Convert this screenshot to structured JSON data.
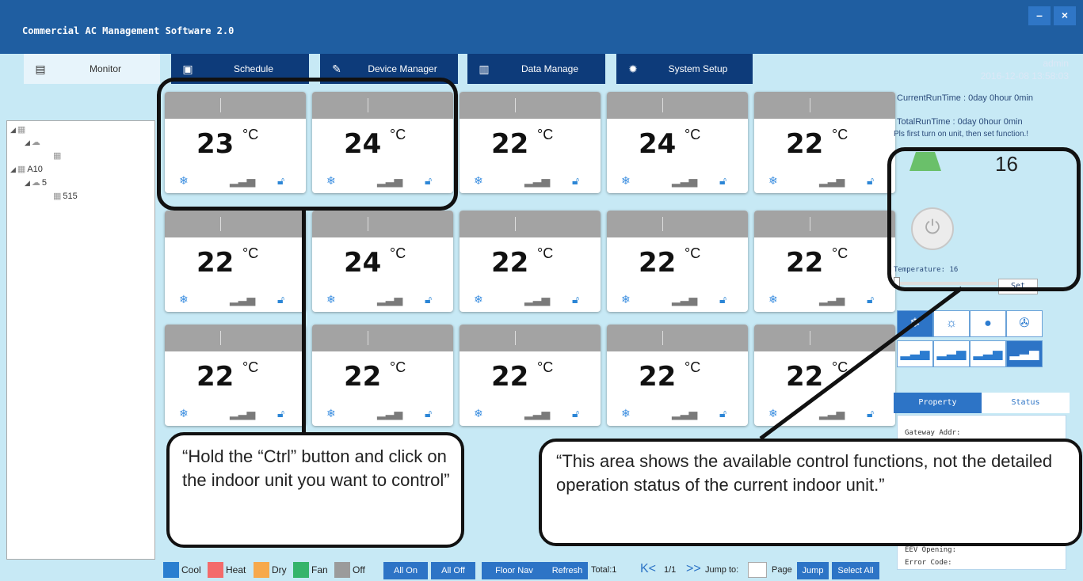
{
  "app": {
    "title": "Commercial AC Management Software 2.0",
    "minimize": "–",
    "close": "×",
    "user": "admin",
    "datetime": "2016-12-08 13:58:03"
  },
  "tabs": [
    {
      "label": "Monitor",
      "icon": "document-icon",
      "active": true
    },
    {
      "label": "Schedule",
      "icon": "calendar-icon"
    },
    {
      "label": "Device Manager",
      "icon": "wrench-icon"
    },
    {
      "label": "Data Manage",
      "icon": "bar-chart-icon"
    },
    {
      "label": "System Setup",
      "icon": "gear-icon"
    }
  ],
  "tree": {
    "nodes": [
      "A10",
      "5",
      "515"
    ]
  },
  "units": [
    {
      "temp": "23",
      "unit": "°C"
    },
    {
      "temp": "24",
      "unit": "°C"
    },
    {
      "temp": "22",
      "unit": "°C"
    },
    {
      "temp": "24",
      "unit": "°C"
    },
    {
      "temp": "22",
      "unit": "°C"
    },
    {
      "temp": "22",
      "unit": "°C"
    },
    {
      "temp": "24",
      "unit": "°C"
    },
    {
      "temp": "22",
      "unit": "°C"
    },
    {
      "temp": "22",
      "unit": "°C"
    },
    {
      "temp": "22",
      "unit": "°C"
    },
    {
      "temp": "22",
      "unit": "°C"
    },
    {
      "temp": "22",
      "unit": "°C"
    },
    {
      "temp": "22",
      "unit": "°C"
    },
    {
      "temp": "22",
      "unit": "°C"
    },
    {
      "temp": "22",
      "unit": "°C"
    }
  ],
  "panel": {
    "current_run_label": "CurrentRunTime :",
    "current_run_value": "0day 0hour 0min",
    "total_run_label": "TotalRunTime :",
    "total_run_value": "0day 0hour 0min",
    "hint": "Pls first turn on unit, then set function.!",
    "set_temp": "16",
    "temperature_label": "Temperature:",
    "temperature_value": "16",
    "set_button": "Set",
    "property_tab": "Property",
    "status_tab": "Status",
    "gateway_label": "Gateway Addr:",
    "eev_label": "EEV Opening:",
    "error_label": "Error Code:"
  },
  "legend": [
    {
      "label": "Cool",
      "color": "#2a7fd0"
    },
    {
      "label": "Heat",
      "color": "#f36b6b"
    },
    {
      "label": "Dry",
      "color": "#f7a94b"
    },
    {
      "label": "Fan",
      "color": "#35b46b"
    },
    {
      "label": "Off",
      "color": "#9b9b9b"
    }
  ],
  "bottom": {
    "all_on": "All On",
    "all_off": "All Off",
    "floor_nav": "Floor Nav",
    "refresh": "Refresh",
    "total": "Total:1",
    "first_prev": "K<",
    "page": "1/1",
    "next_last": ">>",
    "jump_to": "Jump to:",
    "page_label": "Page",
    "jump": "Jump",
    "select_all": "Select All"
  },
  "callouts": {
    "left": "“Hold the “Ctrl” button and click on the indoor unit you want to control”",
    "right": "“This area shows the available control functions, not the detailed operation status of the current indoor unit.”"
  }
}
